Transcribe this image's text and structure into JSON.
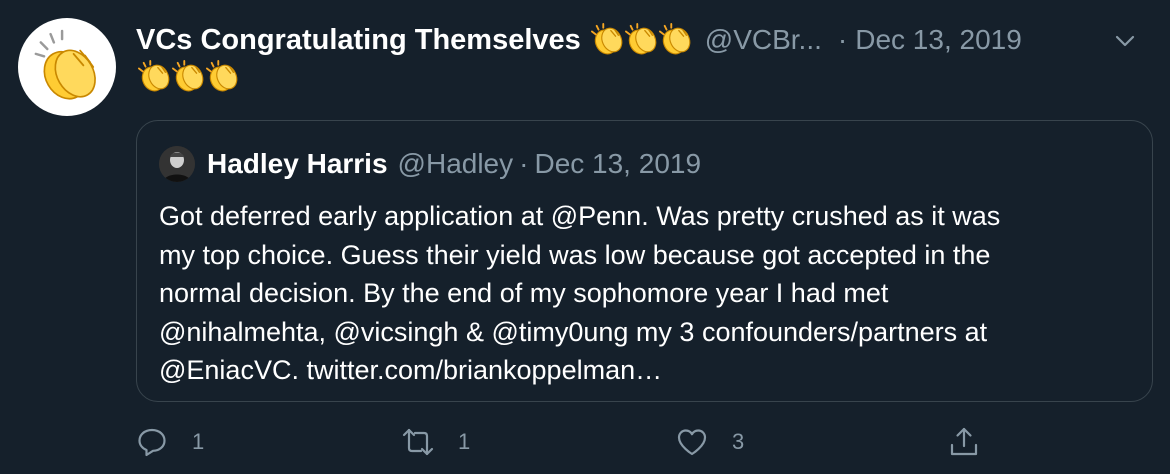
{
  "tweet": {
    "display_name": "VCs Congratulating Themselves",
    "name_emoji": "clapping-hands",
    "handle": "@VCBr...",
    "separator": "·",
    "date": "Dec 13, 2019",
    "text_emoji": "clapping-hands"
  },
  "quote": {
    "name": "Hadley Harris",
    "handle": "@Hadley",
    "separator": "·",
    "date": "Dec 13, 2019",
    "lines": [
      "Got deferred early application at @Penn. Was pretty crushed as it was",
      "my top choice. Guess their yield was low because got accepted in the",
      "normal decision. By the end of my sophomore year I had met",
      "@nihalmehta, @vicsingh & @timy0ung my 3 confounders/partners at",
      "@EniacVC. twitter.com/briankoppelman…"
    ]
  },
  "actions": {
    "replies": "1",
    "retweets": "1",
    "likes": "3"
  },
  "colors": {
    "background": "#15202b",
    "secondary_text": "#8899a6",
    "border": "#38444d",
    "emoji_yellow": "#ffcc33"
  }
}
